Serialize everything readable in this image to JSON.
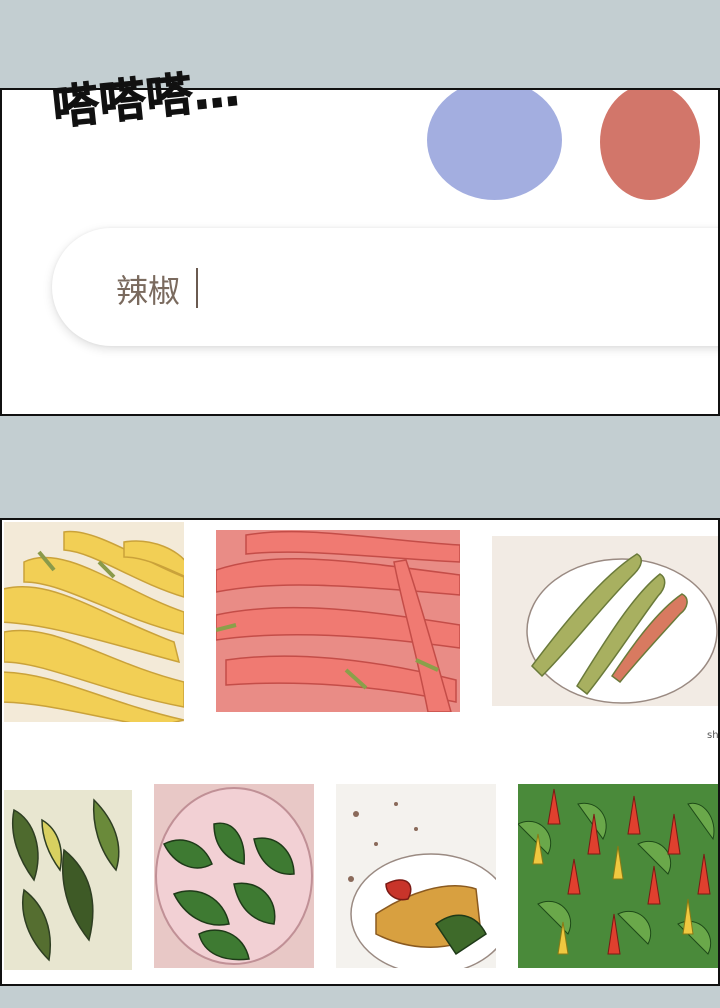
{
  "sound_effect": "嗒嗒嗒…",
  "search": {
    "query": "辣椒"
  },
  "results": [
    {
      "name": "yellow-peppers"
    },
    {
      "name": "red-peppers"
    },
    {
      "name": "peppers-on-plate"
    },
    {
      "name": "peppers-on-plant"
    },
    {
      "name": "green-peppers-bowl"
    },
    {
      "name": "pepper-dish"
    },
    {
      "name": "chili-plants"
    }
  ],
  "tiny_caption": "shi",
  "colors": {
    "background": "#c3ced1",
    "blob_blue": "#a3aee0",
    "blob_red": "#d2766a",
    "search_text": "#7a6a5e"
  }
}
